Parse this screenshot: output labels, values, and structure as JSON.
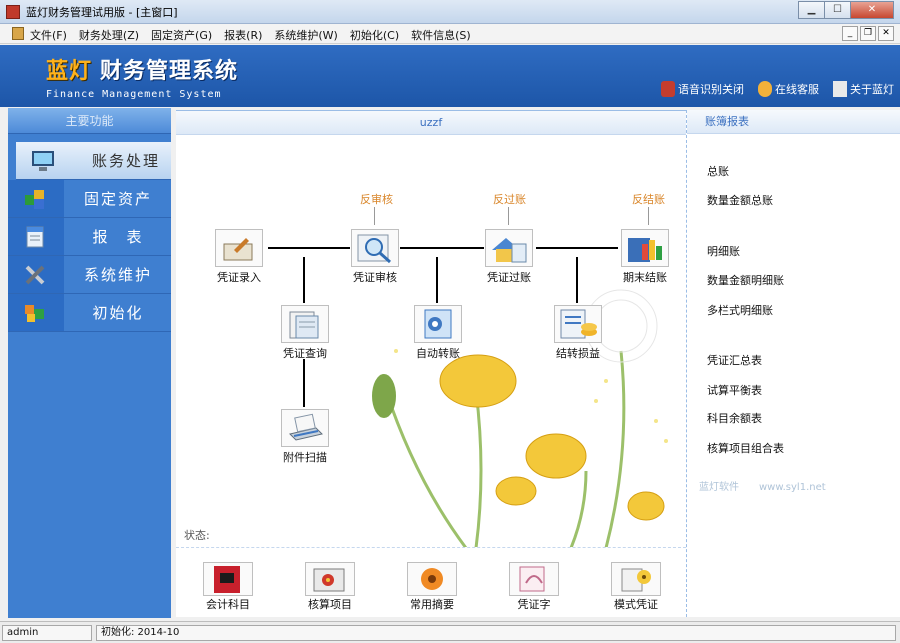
{
  "window": {
    "title": "蓝灯财务管理试用版 - [主窗口]"
  },
  "menu": [
    "文件(F)",
    "财务处理(Z)",
    "固定资产(G)",
    "报表(R)",
    "系统维护(W)",
    "初始化(C)",
    "软件信息(S)"
  ],
  "banner": {
    "brand_part1": "蓝灯",
    "brand_part2": "财务管理系统",
    "subtitle": "Finance Management System",
    "links": [
      "语音识别关闭",
      "在线客服",
      "关于蓝灯"
    ]
  },
  "sidebar": {
    "header": "主要功能",
    "items": [
      "账务处理",
      "固定资产",
      "报　表",
      "系统维护",
      "初始化"
    ]
  },
  "main": {
    "header": "uzzf",
    "status_label": "状态:",
    "nodes": {
      "voucher_entry": "凭证录入",
      "voucher_audit": "凭证审核",
      "voucher_post": "凭证过账",
      "period_close": "期末结账",
      "voucher_query": "凭证查询",
      "auto_transfer": "自动转账",
      "profit_transfer": "结转损益",
      "attachment_scan": "附件扫描"
    },
    "reverse": {
      "unaudit": "反审核",
      "unpost": "反过账",
      "unclose": "反结账"
    }
  },
  "bottom_toolbar": [
    "会计科目",
    "核算项目",
    "常用摘要",
    "凭证字",
    "模式凭证"
  ],
  "right_panel": {
    "header": "账簿报表",
    "links": [
      "总账",
      "数量金额总账",
      "明细账",
      "数量金额明细账",
      "多栏式明细账",
      "凭证汇总表",
      "试算平衡表",
      "科目余额表",
      "核算项目组合表"
    ],
    "footer": "蓝灯软件　　www.syl1.net"
  },
  "statusbar": {
    "user": "admin",
    "init_info": "初始化: 2014-10"
  },
  "colors": {
    "banner": "#2f6cc2",
    "sidebar": "#3f7fd0",
    "accent_orange": "#d9862a",
    "brand_orange": "#ffb21a"
  }
}
